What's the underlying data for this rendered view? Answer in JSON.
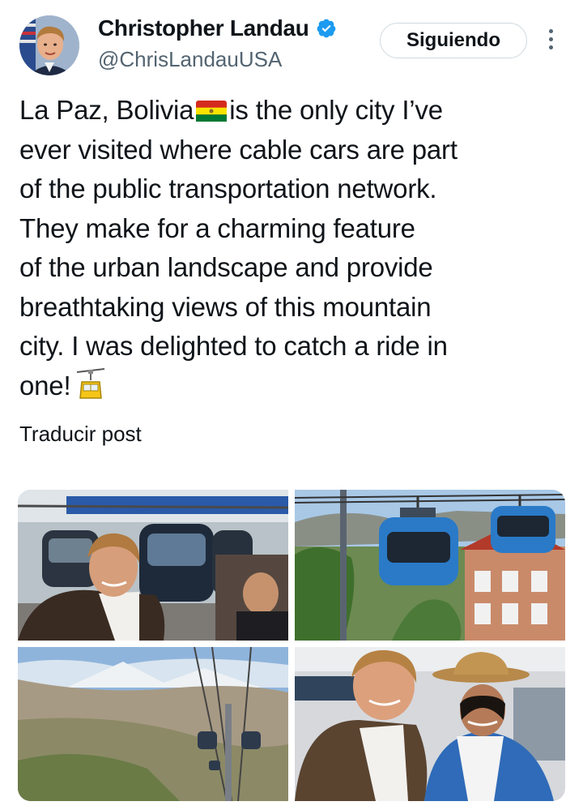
{
  "author": {
    "name": "Christopher Landau",
    "handle": "@ChrisLandauUSA",
    "verified_icon": "verified-badge-icon",
    "avatar_icon": "avatar-portrait"
  },
  "follow_button": {
    "label": "Siguiendo"
  },
  "more_menu": {
    "icon": "more-vertical-icon"
  },
  "post": {
    "lines": [
      {
        "before": "La Paz, Bolivia",
        "after": "is the only city I’ve"
      },
      "ever visited where cable cars are part",
      "of the public transportation network.",
      "They make for a charming feature",
      "of the urban landscape and provide",
      "breathtaking views of this mountain",
      "city. I was delighted to catch a ride in",
      "one!"
    ],
    "flag_emoji": "bolivia-flag-icon",
    "end_emoji": "aerial-tramway-icon"
  },
  "translate_link": "Traducir post",
  "media": {
    "photos": [
      "photo-selfie-cable-car-station",
      "photo-blue-cable-cars-over-houses",
      "photo-city-view-mountains-cables",
      "photo-selfie-with-woman-in-hat"
    ]
  },
  "colors": {
    "text": "#0f1419",
    "secondary": "#536471",
    "verified": "#1d9bf0",
    "border": "#cfd9de"
  }
}
